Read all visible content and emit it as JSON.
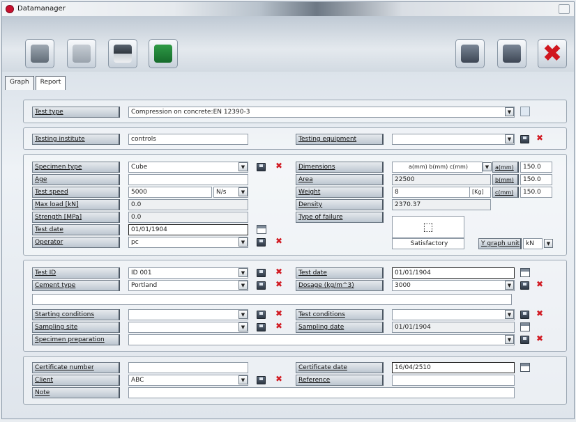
{
  "window": {
    "title": "Datamanager"
  },
  "toolbar": {
    "left_icons": [
      "database-icon",
      "database-disabled-icon",
      "printer-icon",
      "excel-icon"
    ],
    "right_icons": [
      "save-icon",
      "save-as-icon",
      "close-x-icon"
    ]
  },
  "tabs": [
    "Graph",
    "Report"
  ],
  "test_type": {
    "label": "Test type",
    "value": "Compression on concrete:EN 12390-3"
  },
  "institute": {
    "label": "Testing institute",
    "value": "controls",
    "equip_label": "Testing equipment",
    "equip_value": ""
  },
  "specimen": {
    "type_label": "Specimen type",
    "type_value": "Cube",
    "age_label": "Age",
    "age_value": "",
    "speed_label": "Test speed",
    "speed_value": "5000",
    "speed_unit": "N/s",
    "maxload_label": "Max load [kN]",
    "maxload_value": "0.0",
    "strength_label": "Strength [MPa]",
    "strength_value": "0.0",
    "date_label": "Test date",
    "date_value": "01/01/1904",
    "operator_label": "Operator",
    "operator_value": "pc",
    "dim_label": "Dimensions",
    "dim_value": "a(mm) b(mm) c(mm)",
    "area_label": "Area",
    "area_value": "22500",
    "weight_label": "Weight",
    "weight_value": "8",
    "weight_unit": "[Kg]",
    "density_label": "Density",
    "density_value": "2370.37",
    "failure_label": "Type of failure",
    "failure_value": "Satisfactory",
    "a_label": "a(mm)",
    "a_value": "150.0",
    "b_label": "b(mm)",
    "b_value": "150.0",
    "c_label": "c(mm)",
    "c_value": "150.0",
    "ygraph_label": "Y graph unit",
    "ygraph_value": "kN"
  },
  "test": {
    "id_label": "Test ID",
    "id_value": "ID 001",
    "cement_label": "Cement type",
    "cement_value": "Portland",
    "tdate_label": "Test date",
    "tdate_value": "01/01/1904",
    "dosage_label": "Dosage (kg/m^3)",
    "dosage_value": "3000",
    "start_label": "Starting conditions",
    "start_value": "",
    "sampling_label": "Sampling site",
    "sampling_value": "",
    "prep_label": "Specimen preparation",
    "prep_value": "",
    "cond_label": "Test conditions",
    "cond_value": "",
    "sdate_label": "Sampling date",
    "sdate_value": "01/01/1904"
  },
  "cert": {
    "num_label": "Certificate number",
    "num_value": "",
    "client_label": "Client",
    "client_value": "ABC",
    "note_label": "Note",
    "note_value": "",
    "cdate_label": "Certificate date",
    "cdate_value": "16/04/2510",
    "ref_label": "Reference",
    "ref_value": ""
  }
}
